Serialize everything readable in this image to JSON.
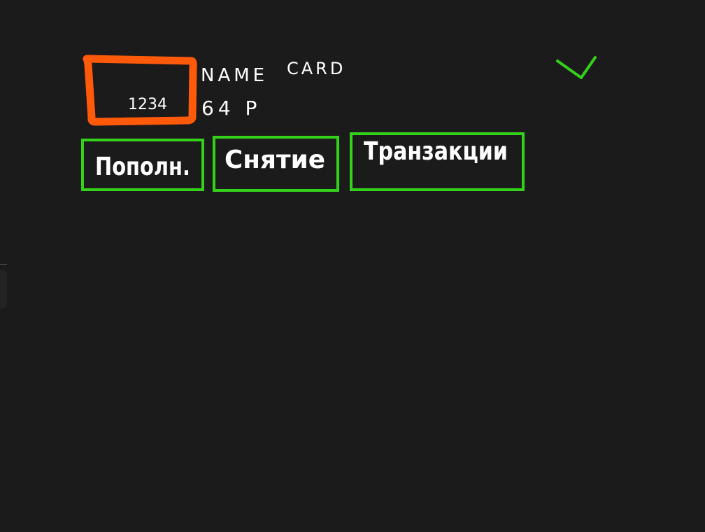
{
  "card": {
    "number": "1234",
    "name_line": "NAME",
    "card_word": "CARD",
    "balance_line": "64 Р"
  },
  "buttons": [
    {
      "label": "Пополн."
    },
    {
      "label": "Снятие"
    },
    {
      "label": "Транзакции"
    }
  ],
  "colors": {
    "background": "#1b1b1b",
    "card_outline": "#ff5a0a",
    "button_outline": "#34d11a",
    "check_mark": "#34d11a",
    "ink": "#ffffff"
  },
  "icons": {
    "check": "checkmark-icon"
  }
}
